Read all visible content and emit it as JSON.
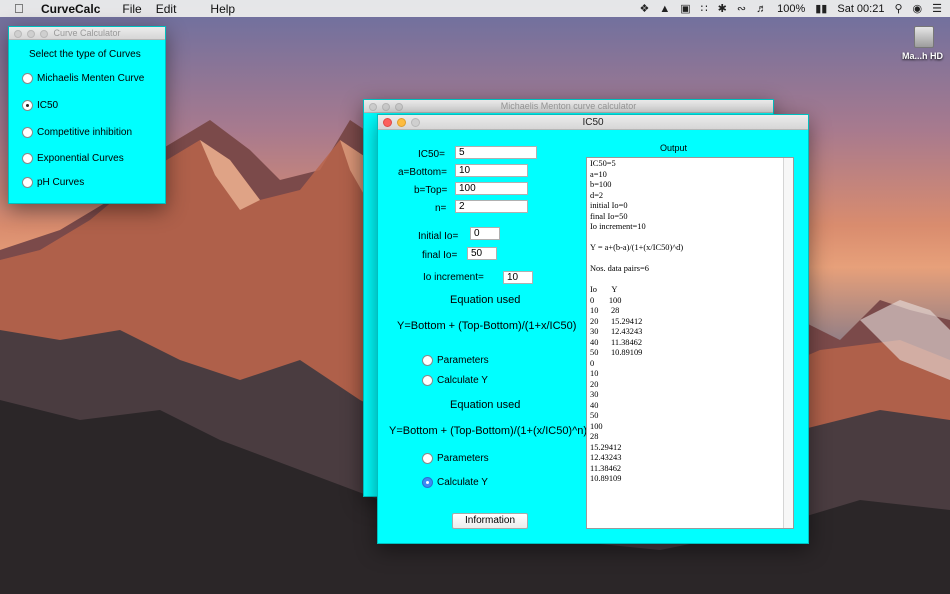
{
  "menubar": {
    "app_name": "CurveCalc",
    "menus": [
      "File",
      "Edit",
      "Help"
    ],
    "status": {
      "battery": "100%",
      "clock": "Sat 00:21"
    }
  },
  "desktop": {
    "disk_label": "Ma...h HD"
  },
  "curve_window": {
    "title": "Curve Calculator",
    "prompt": "Select the type of Curves",
    "options": [
      "Michaelis Menten Curve",
      "IC50",
      "Competitive inhibition",
      "Exponential Curves",
      "pH Curves"
    ],
    "selected": "IC50"
  },
  "mm_window": {
    "title": "Michaelis Menton curve calculator"
  },
  "ic50_window": {
    "title": "IC50",
    "fields": {
      "ic50_label": "IC50=",
      "ic50_value": "5",
      "bottom_label": "a=Bottom=",
      "bottom_value": "10",
      "top_label": "b=Top=",
      "top_value": "100",
      "n_label": "n=",
      "n_value": "2",
      "initial_label": "Initial Io=",
      "initial_value": "0",
      "final_label": "final Io=",
      "final_value": "50",
      "increment_label": "Io increment=",
      "increment_value": "10"
    },
    "section1": {
      "heading": "Equation used",
      "equation": "Y=Bottom + (Top-Bottom)/(1+x/IC50)",
      "opt_params": "Parameters",
      "opt_calc": "Calculate Y"
    },
    "section2": {
      "heading": "Equation used",
      "equation": "Y=Bottom + (Top-Bottom)/(1+(x/IC50)^n)",
      "opt_params": "Parameters",
      "opt_calc": "Calculate Y"
    },
    "info_button": "Information",
    "output_title": "Output",
    "output_lines": [
      "IC50=5",
      "a=10",
      "b=100",
      "d=2",
      "initial Io=0",
      "final Io=50",
      "Io increment=10",
      "",
      "Y = a+(b-a)/(1+(x/IC50)^d)",
      "",
      "Nos. data pairs=6",
      "",
      "Io       Y",
      "0       100",
      "10      28",
      "20      15.29412",
      "30      12.43243",
      "40      11.38462",
      "50      10.89109",
      "0",
      "10",
      "20",
      "30",
      "40",
      "50",
      "100",
      "28",
      "15.29412",
      "12.43243",
      "11.38462",
      "10.89109"
    ]
  }
}
